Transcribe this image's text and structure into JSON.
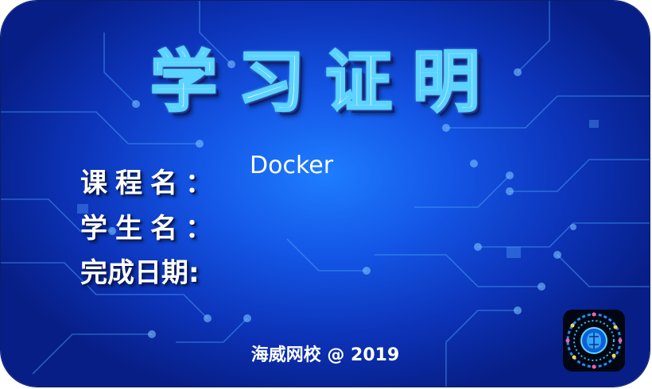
{
  "certificate": {
    "title": "学习证明",
    "fields": [
      {
        "label": "课程名：",
        "value": "Docker"
      },
      {
        "label": "学生名：",
        "value": ""
      },
      {
        "label": "完成日期:",
        "value": ""
      }
    ],
    "footer": "海威网校 @ 2019"
  },
  "colors": {
    "background_center": "#1e7dff",
    "background_edge": "#071e86",
    "title_glow": "#5bd3ff",
    "text": "#ffffff"
  },
  "logo": {
    "icon": "brain-circuit-logo-icon"
  }
}
